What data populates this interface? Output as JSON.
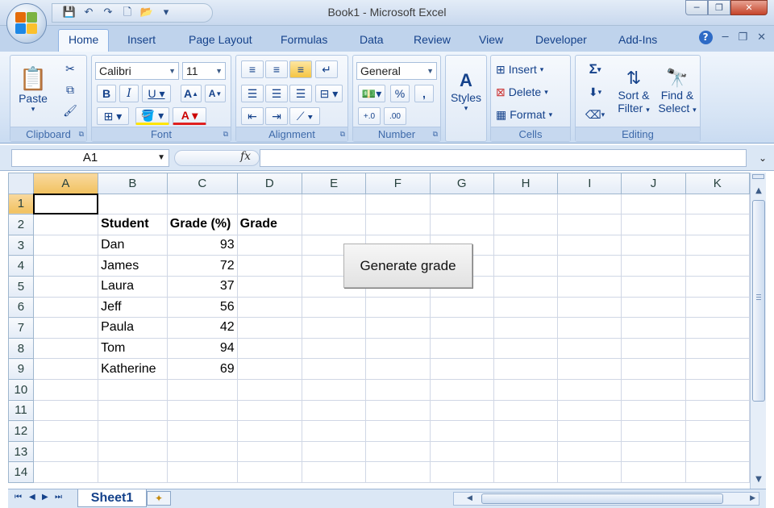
{
  "window": {
    "title": "Book1 - Microsoft Excel",
    "controls": [
      "─",
      "❐",
      "✕"
    ]
  },
  "qat": {
    "save": "💾",
    "undo": "↶",
    "redo": "↷",
    "new": "🗋",
    "open": "📂",
    "customize": "▾"
  },
  "tabs": [
    "Home",
    "Insert",
    "Page Layout",
    "Formulas",
    "Data",
    "Review",
    "View",
    "Developer",
    "Add-Ins"
  ],
  "active_tab": "Home",
  "ribbon": {
    "clipboard": {
      "label": "Clipboard",
      "paste": "Paste"
    },
    "font": {
      "label": "Font",
      "name": "Calibri",
      "size": "11"
    },
    "alignment": {
      "label": "Alignment"
    },
    "number": {
      "label": "Number",
      "format": "General"
    },
    "styles": {
      "label": "Styles"
    },
    "cells": {
      "label": "Cells",
      "insert": "Insert",
      "delete": "Delete",
      "format": "Format"
    },
    "editing": {
      "label": "Editing",
      "sort_filter_1": "Sort &",
      "sort_filter_2": "Filter",
      "find_select_1": "Find &",
      "find_select_2": "Select"
    }
  },
  "formula_bar": {
    "name_box": "A1",
    "fx": "fx",
    "value": ""
  },
  "grid": {
    "columns": [
      "A",
      "B",
      "C",
      "D",
      "E",
      "F",
      "G",
      "H",
      "I",
      "J",
      "K"
    ],
    "rows": [
      "1",
      "2",
      "3",
      "4",
      "5",
      "6",
      "7",
      "8",
      "9",
      "10",
      "11",
      "12",
      "13",
      "14"
    ],
    "cells": {
      "B2": "Student",
      "C2": "Grade (%)",
      "D2": "Grade",
      "B3": "Dan",
      "C3": "93",
      "B4": "James",
      "C4": "72",
      "B5": "Laura",
      "C5": "37",
      "B6": "Jeff",
      "C6": "56",
      "B7": "Paula",
      "C7": "42",
      "B8": "Tom",
      "C8": "94",
      "B9": "Katherine",
      "C9": "69"
    },
    "active_cell": "A1"
  },
  "macro_button": {
    "label": "Generate grade"
  },
  "sheets": {
    "active": "Sheet1"
  },
  "colors": {
    "ribbon_text": "#15428b",
    "active_header": "#f1c15f",
    "gridline": "#d0d7e5"
  }
}
